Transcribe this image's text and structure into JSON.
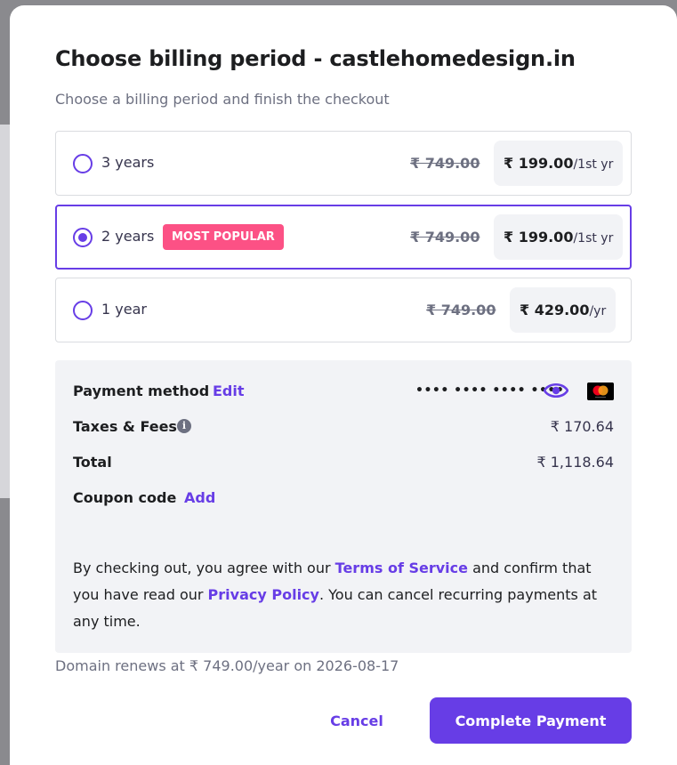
{
  "modal": {
    "title": "Choose billing period - castlehomedesign.in",
    "subtitle": "Choose a billing period and finish the checkout"
  },
  "options": [
    {
      "label": "3 years",
      "badge": "",
      "old_price": "₹ 749.00",
      "price": "₹ 199.00",
      "unit": "/1st yr",
      "selected": false
    },
    {
      "label": "2 years",
      "badge": "MOST POPULAR",
      "old_price": "₹ 749.00",
      "price": "₹ 199.00",
      "unit": "/1st yr",
      "selected": true
    },
    {
      "label": "1 year",
      "badge": "",
      "old_price": "₹ 749.00",
      "price": "₹ 429.00",
      "unit": "/yr",
      "selected": false
    }
  ],
  "summary": {
    "payment_label": "Payment method",
    "payment_edit": "Edit",
    "card_masked": "•••• •••• •••• ••••",
    "taxes_label": "Taxes & Fees",
    "info_glyph": "i",
    "taxes_value": "₹ 170.64",
    "total_label": "Total",
    "total_value": "₹ 1,118.64",
    "coupon_label": "Coupon code",
    "coupon_add": "Add",
    "terms_pre": "By checking out, you agree with our ",
    "terms_link": "Terms of Service",
    "terms_mid": " and confirm that you have read our ",
    "privacy_link": "Privacy Policy",
    "terms_post": ". You can cancel recurring payments at any time."
  },
  "renews_text": "Domain renews at ₹ 749.00/year on 2026-08-17",
  "buttons": {
    "cancel": "Cancel",
    "complete": "Complete Payment"
  },
  "colors": {
    "accent": "#673de6",
    "badge": "#fc5185",
    "panel": "#f2f3f6"
  },
  "icons": {
    "eye": "eye-icon",
    "card": "mastercard-icon",
    "info": "info-icon"
  }
}
